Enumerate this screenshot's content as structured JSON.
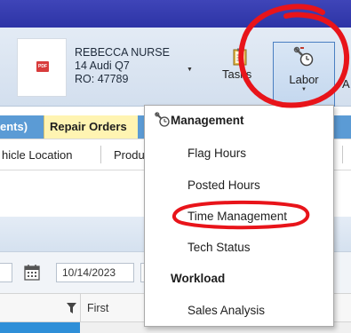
{
  "ribbon": {
    "customer_name": "REBECCA NURSE",
    "vehicle": "14 Audi Q7",
    "ro_number": "RO: 47789",
    "pdf_icon_text": "PDF",
    "tasks_label": "Tasks",
    "labor_label": "Labor",
    "next_label_cut": "A"
  },
  "tabs": {
    "events_label": "ents)",
    "repair_orders_label": "Repair Orders"
  },
  "nav": {
    "vehicle_location": "hicle Location",
    "products": "Produ"
  },
  "filters": {
    "date_value": "10/14/2023"
  },
  "grid": {
    "first_col_header": "First"
  },
  "menu": {
    "management_group": "Management",
    "items": [
      "Flag Hours",
      "Posted Hours",
      "Time Management",
      "Tech Status"
    ],
    "workload_group": "Workload",
    "workload_items": [
      "Sales Analysis"
    ]
  },
  "colors": {
    "title_band": "#2d34a6",
    "tab_blue": "#5b9bd5",
    "repair_tab": "#fff4b2",
    "annotation_red": "#e8141a"
  }
}
